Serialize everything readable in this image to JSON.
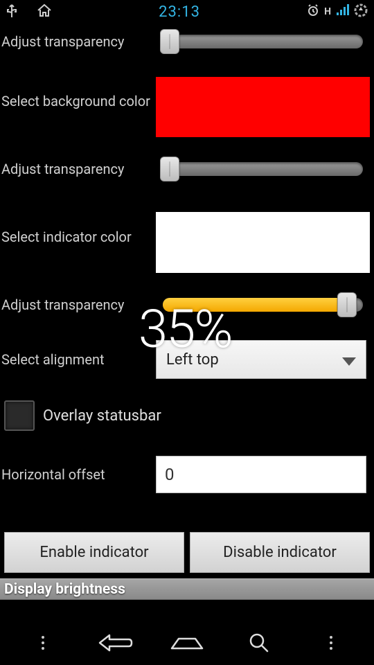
{
  "statusbar": {
    "time": "23:13",
    "network_label": "H"
  },
  "overlay_percent": "35%",
  "rows": {
    "trans1_label": "Adjust transparency",
    "bg_color_label": "Select background color",
    "trans2_label": "Adjust transparency",
    "ind_color_label": "Select indicator color",
    "trans3_label": "Adjust transparency",
    "alignment_label": "Select alignment",
    "alignment_value": "Left top",
    "overlay_checkbox_label": "Overlay statusbar",
    "hoffset_label": "Horizontal offset",
    "hoffset_value": "0"
  },
  "sliders": {
    "trans1_pos_pct": 2,
    "trans2_pos_pct": 2,
    "trans3_pos_pct": 87,
    "trans3_fill_pct": 86
  },
  "colors": {
    "bg_swatch": "#ff0000",
    "indicator_swatch": "#ffffff",
    "slider_fill": "#f4a800"
  },
  "buttons": {
    "enable": "Enable indicator",
    "disable": "Disable indicator"
  },
  "section_header": "Display brightness"
}
